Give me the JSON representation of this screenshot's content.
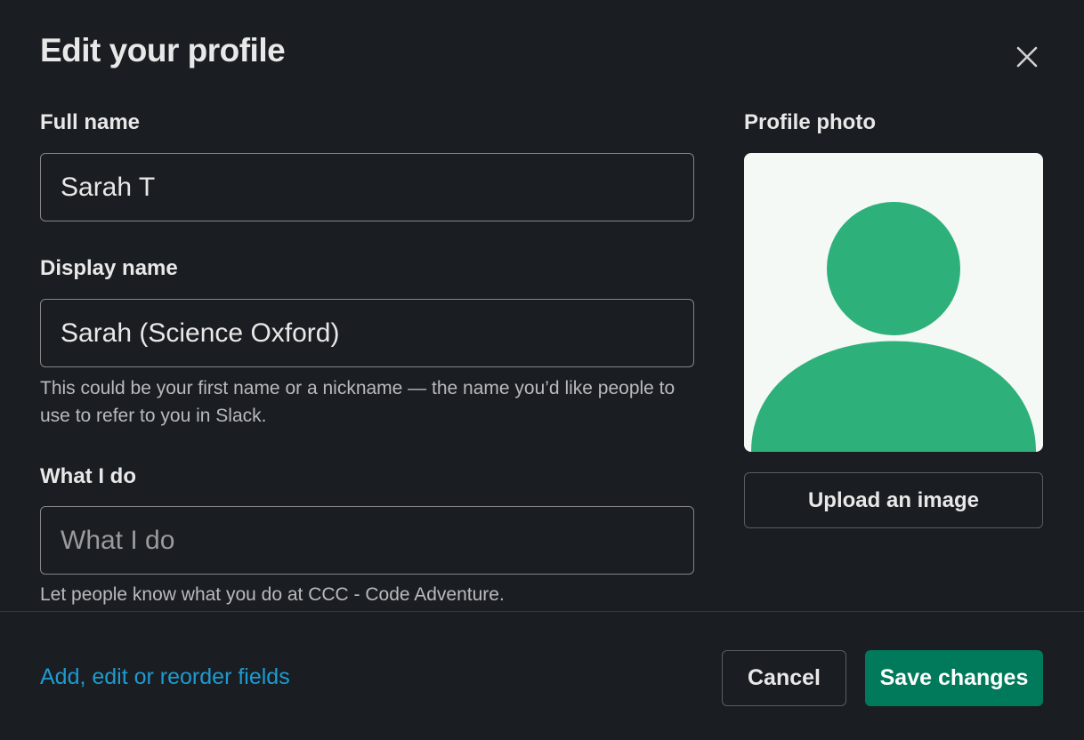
{
  "modal": {
    "title": "Edit your profile",
    "close_icon": "close-icon"
  },
  "fields": {
    "full_name": {
      "label": "Full name",
      "value": "Sarah T"
    },
    "display_name": {
      "label": "Display name",
      "value": "Sarah (Science Oxford)",
      "hint": "This could be your first name or a nickname — the name you’d like people to use to refer to you in Slack."
    },
    "what_i_do": {
      "label": "What I do",
      "value": "",
      "placeholder": "What I do",
      "hint": "Let people know what you do at CCC - Code Adventure."
    }
  },
  "photo": {
    "label": "Profile photo",
    "avatar_icon": "default-avatar-icon",
    "avatar_color": "#2eb07a",
    "background_color": "#f4f9f6",
    "upload_label": "Upload an image"
  },
  "footer": {
    "link_label": "Add, edit or reorder fields",
    "cancel_label": "Cancel",
    "save_label": "Save changes",
    "save_color": "#007a5a",
    "link_color": "#1d9bd1"
  }
}
